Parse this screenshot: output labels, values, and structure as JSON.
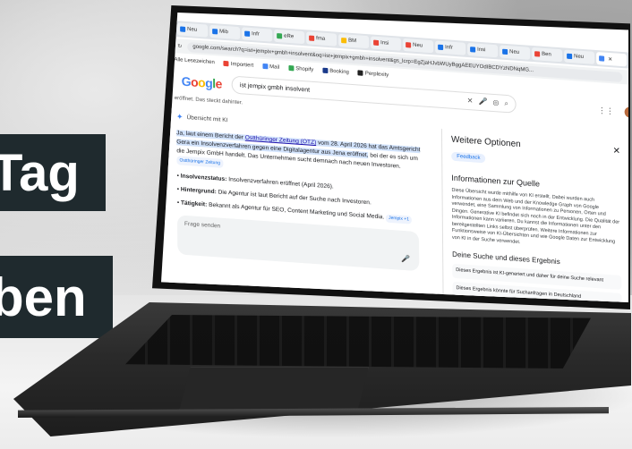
{
  "overlay": {
    "line1": "Tag",
    "line2": "ben"
  },
  "browser": {
    "tabs": [
      "Neu",
      "Mib",
      "Infr",
      "eRe",
      "fma",
      "BM",
      "Insi",
      "Neu",
      "Infr",
      "Insi",
      "Neu",
      "Ben",
      "Neu",
      ""
    ],
    "url": "google.com/search?q=ist+jempix+gmbh+insolvent&oq=ist+jempix+gmbh+insolvent&gs_lcrp=EgZjaHJvbWUyBggAEEUYOdIBCDYzNDNqMG...",
    "bookmarks": [
      "Alle Lesezeichen",
      "Importiert",
      "Mail",
      "Shopify",
      "Booking",
      "Perplexity"
    ]
  },
  "google": {
    "query": "ist jempix gmbh insolvent",
    "subnote": "eröffnet. Das steckt dahinter.",
    "ai_overview": {
      "title": "Übersicht mit KI",
      "p1_a": "Ja, laut einem Bericht der ",
      "p1_link": "Ostthüringer Zeitung (OTZ)",
      "p1_b": " vom 28. April 2026 hat das Amtsgericht Gera ein Insolvenzverfahren gegen eine Digitalagentur aus Jena eröffnet,",
      "p1_c": " bei der es sich um die Jempix GmbH handelt. Das Unternehmen sucht demnach nach neuen Investoren.",
      "source_chip": "Ostthüringer Zeitung",
      "bullets": [
        {
          "label": "Insolvenzstatus:",
          "text": " Insolvenzverfahren eröffnet (April 2026)."
        },
        {
          "label": "Hintergrund:",
          "text": " Die Agentur ist laut Bericht auf der Suche nach Investoren."
        },
        {
          "label": "Tätigkeit:",
          "text": " Bekannt als Agentur für SEO, Content Marketing und Social Media."
        }
      ],
      "chip2": "Jempix +1",
      "ask_placeholder": "Frage senden"
    },
    "side_panel": {
      "title": "Weitere Optionen",
      "feedback": "Feedback",
      "info_heading": "Informationen zur Quelle",
      "info_text": "Diese Übersicht wurde mithilfe von KI erstellt. Dabei wurden auch Informationen aus dem Web und der Knowledge Graph von Google verwendet, eine Sammlung von Informationen zu Personen, Orten und Dingen. Generative KI befindet sich noch in der Entwicklung. Die Qualität der Informationen kann variieren. Du kannst die Informationen unter den bereitgestellten Links selbst überprüfen. Weitere Informationen zur Funktionsweise von KI-Übersichten und wie Google Daten zur Entwicklung von KI in der Suche verwendet.",
      "section2": "Deine Suche und dieses Ergebnis",
      "items": [
        "Dieses Ergebnis ist KI-generiert und daher für deine Suche relevant",
        "Dieses Ergebnis könnte für Suchanfragen in Deutschland"
      ]
    }
  }
}
